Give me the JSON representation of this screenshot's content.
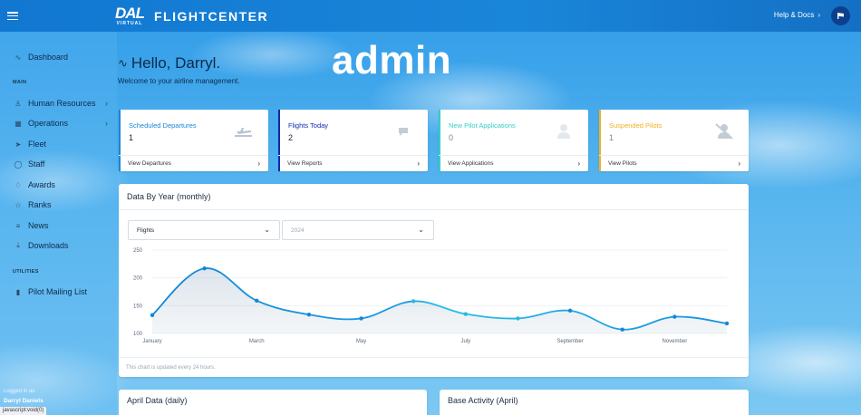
{
  "topbar": {
    "brand_logo": "DAL",
    "brand_logo_sub": "VIRTUAL",
    "brand_name": "FLIGHTCENTER",
    "help_label": "Help & Docs"
  },
  "sidebar": {
    "items": [
      {
        "label": "Dashboard",
        "icon": "pulse-icon",
        "glyph": "∿"
      },
      {
        "label": "Human Resources",
        "icon": "person-icon",
        "glyph": "♙",
        "has_children": true
      },
      {
        "label": "Operations",
        "icon": "grid-icon",
        "glyph": "▦",
        "has_children": true
      },
      {
        "label": "Fleet",
        "icon": "send-icon",
        "glyph": "➤"
      },
      {
        "label": "Staff",
        "icon": "shield-icon",
        "glyph": "◯"
      },
      {
        "label": "Awards",
        "icon": "award-icon",
        "glyph": "♢"
      },
      {
        "label": "Ranks",
        "icon": "star-icon",
        "glyph": "☆"
      },
      {
        "label": "News",
        "icon": "news-icon",
        "glyph": "≡"
      },
      {
        "label": "Downloads",
        "icon": "download-icon",
        "glyph": "⤓"
      },
      {
        "label": "Pilot Mailing List",
        "icon": "bar-chart-icon",
        "glyph": "▮"
      }
    ],
    "sections": [
      "MAIN",
      "UTILITIES"
    ],
    "logged_in_label": "Logged in as",
    "logged_in_name": "Darryl Daniels",
    "status_text": "javascript:void(0)"
  },
  "greeting": {
    "title": "Hello, Darryl.",
    "subtitle": "Welcome to your airline management.",
    "overlay": "admin"
  },
  "cards": [
    {
      "title": "Scheduled Departures",
      "value": "1",
      "link": "View Departures",
      "color": "#1a86d9",
      "icon": "departure-icon"
    },
    {
      "title": "Flights Today",
      "value": "2",
      "link": "View Reports",
      "color": "#0d2bb0",
      "icon": "chat-icon"
    },
    {
      "title": "New Pilot Applications",
      "value": "0",
      "link": "View Applications",
      "color": "#33cfc7",
      "icon": "user-icon"
    },
    {
      "title": "Suspended Pilots",
      "value": "1",
      "link": "View Pilots",
      "color": "#f2b01e",
      "icon": "user-slash-icon"
    }
  ],
  "chart_panel": {
    "title": "Data By Year (monthly)",
    "metric_select": "Flights",
    "year_select": "2024",
    "note": "This chart is updated every 24 hours."
  },
  "chart_data": {
    "type": "area",
    "x": [
      "January",
      "February",
      "March",
      "April",
      "May",
      "June",
      "July",
      "August",
      "September",
      "October",
      "November",
      "December"
    ],
    "tick_labels": [
      "January",
      "March",
      "May",
      "July",
      "September",
      "November"
    ],
    "series": [
      {
        "values": [
          133,
          217,
          159,
          134,
          127,
          158,
          135,
          127,
          141,
          107,
          130,
          118
        ]
      }
    ],
    "ylim": [
      100,
      250
    ],
    "yticks": [
      100,
      150,
      200,
      250
    ],
    "grid": true,
    "color": "#1a8fe0"
  },
  "bottom_panels": {
    "left_title": "April Data (daily)",
    "right_title": "Base Activity (April)"
  }
}
